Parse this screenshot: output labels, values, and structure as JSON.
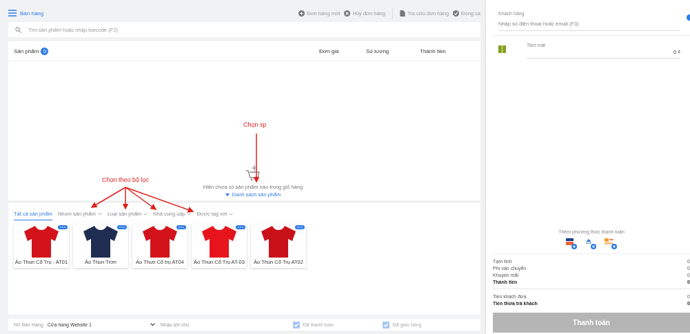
{
  "header": {
    "title": "Bán hàng",
    "actions": [
      {
        "label": "Đơn hàng mới",
        "kind": "plus"
      },
      {
        "label": "Hủy đơn hàng",
        "kind": "cancel"
      },
      {
        "label": "Tra cứu đơn hàng",
        "kind": "doc"
      },
      {
        "label": "Đóng ca",
        "kind": "check"
      }
    ]
  },
  "search": {
    "placeholder": "Tìm sản phẩm hoặc nhập barcode (F2)"
  },
  "cart": {
    "columns": [
      "Sản phẩm",
      "Đơn giá",
      "Số lượng",
      "Thành tiền"
    ],
    "count": "0",
    "empty_message": "Hiện chưa có sản phẩm nào trong giỏ hàng",
    "toggle": "Danh sách sản phẩm"
  },
  "filters": [
    {
      "label": "Tất cả sản phẩm",
      "selected": true,
      "dropdown": false
    },
    {
      "label": "Nhóm sản phẩm",
      "selected": false,
      "dropdown": true
    },
    {
      "label": "Loại sản phẩm",
      "selected": false,
      "dropdown": true
    },
    {
      "label": "Nhà cung cấp",
      "selected": false,
      "dropdown": true
    },
    {
      "label": "Được tag với",
      "selected": false,
      "dropdown": true
    }
  ],
  "products": [
    {
      "name": "Áo Thun Cổ Trụ - AT01",
      "color": "#d3121b"
    },
    {
      "name": "Áo Thun Trơn",
      "color": "#1f2d52"
    },
    {
      "name": "Áo Thun Cổ trụ AT04",
      "color": "#d3121b"
    },
    {
      "name": "Áo Thun Cổ Trụ AT-03",
      "color": "#e8141c"
    },
    {
      "name": "Áo Thun Cổ Trụ AT02",
      "color": "#c9111a"
    }
  ],
  "footer": {
    "staff_label": "NV Bán Hàng",
    "store": "Cửa hàng Website 1",
    "note_placeholder": "Nhập ghi chú",
    "checks": [
      {
        "label": "Đã thanh toán",
        "checked": true
      },
      {
        "label": "Đã giao hàng",
        "checked": true
      }
    ]
  },
  "customer": {
    "label": "Khách hàng",
    "placeholder": "Nhập số điện thoại hoặc email (F3)"
  },
  "payment": {
    "method": "Tiền mặt",
    "amount": "0 ₫",
    "add_label": "Thêm phương thức thanh toán",
    "methods": [
      {
        "kind": "card"
      },
      {
        "kind": "bank"
      },
      {
        "kind": "cod"
      }
    ]
  },
  "summary": [
    {
      "label": "Tạm tính",
      "value": "0",
      "bold": false
    },
    {
      "label": "Phí vận chuyển",
      "value": "0",
      "bold": false
    },
    {
      "label": "Khuyến mãi",
      "value": "0",
      "bold": false
    },
    {
      "label": "Thành tiền",
      "value": "0",
      "bold": true
    }
  ],
  "cash": [
    {
      "label": "Tiền khách đưa",
      "value": "0",
      "bold": false
    },
    {
      "label": "Tiền thừa trả khách",
      "value": "0",
      "bold": true
    }
  ],
  "pay_button": {
    "label": "Thanh toán",
    "disabled": true
  },
  "annotations": [
    {
      "text": "Chọn sp"
    },
    {
      "text": "Chọn theo bộ lọc"
    }
  ]
}
